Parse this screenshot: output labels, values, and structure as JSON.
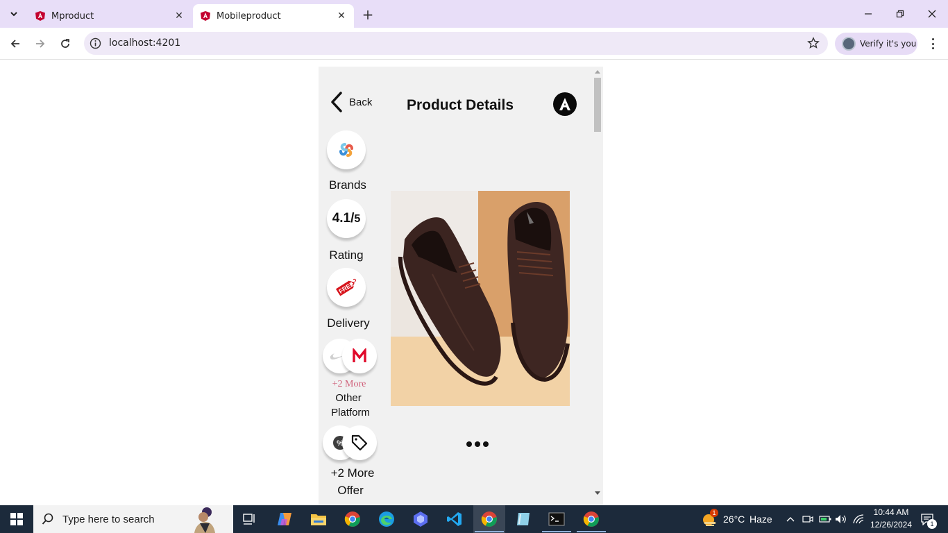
{
  "browser": {
    "tabs": [
      {
        "title": "Mproduct",
        "active": false
      },
      {
        "title": "Mobileproduct",
        "active": true
      }
    ],
    "url": "localhost:4201",
    "verify_label": "Verify it's you"
  },
  "page": {
    "back_label": "Back",
    "title": "Product Details",
    "sidebar": {
      "brands_label": "Brands",
      "rating_value": "4.1/",
      "rating_scale": "5",
      "rating_label": "Rating",
      "free_tag": "FREE",
      "delivery_label": "Delivery",
      "platforms_more": "+2 More",
      "platform_label_1": "Other",
      "platform_label_2": "Platform",
      "offer_label_1": "+2 More",
      "offer_label_2": "Offer"
    },
    "carousel": {
      "pages": 3,
      "active_index": 0
    }
  },
  "taskbar": {
    "search_placeholder": "Type here to search",
    "weather_temp": "26°C",
    "weather_desc": "Haze",
    "weather_badge": "1",
    "time": "10:44 AM",
    "date": "12/26/2024",
    "notification_count": "1"
  },
  "colors": {
    "tabbar_bg": "#e8def8",
    "omnibox_bg": "#efe9f7",
    "page_panel_bg": "#f1f1f1",
    "taskbar_bg": "#1c2a3b",
    "accent_red": "#d0607a"
  }
}
